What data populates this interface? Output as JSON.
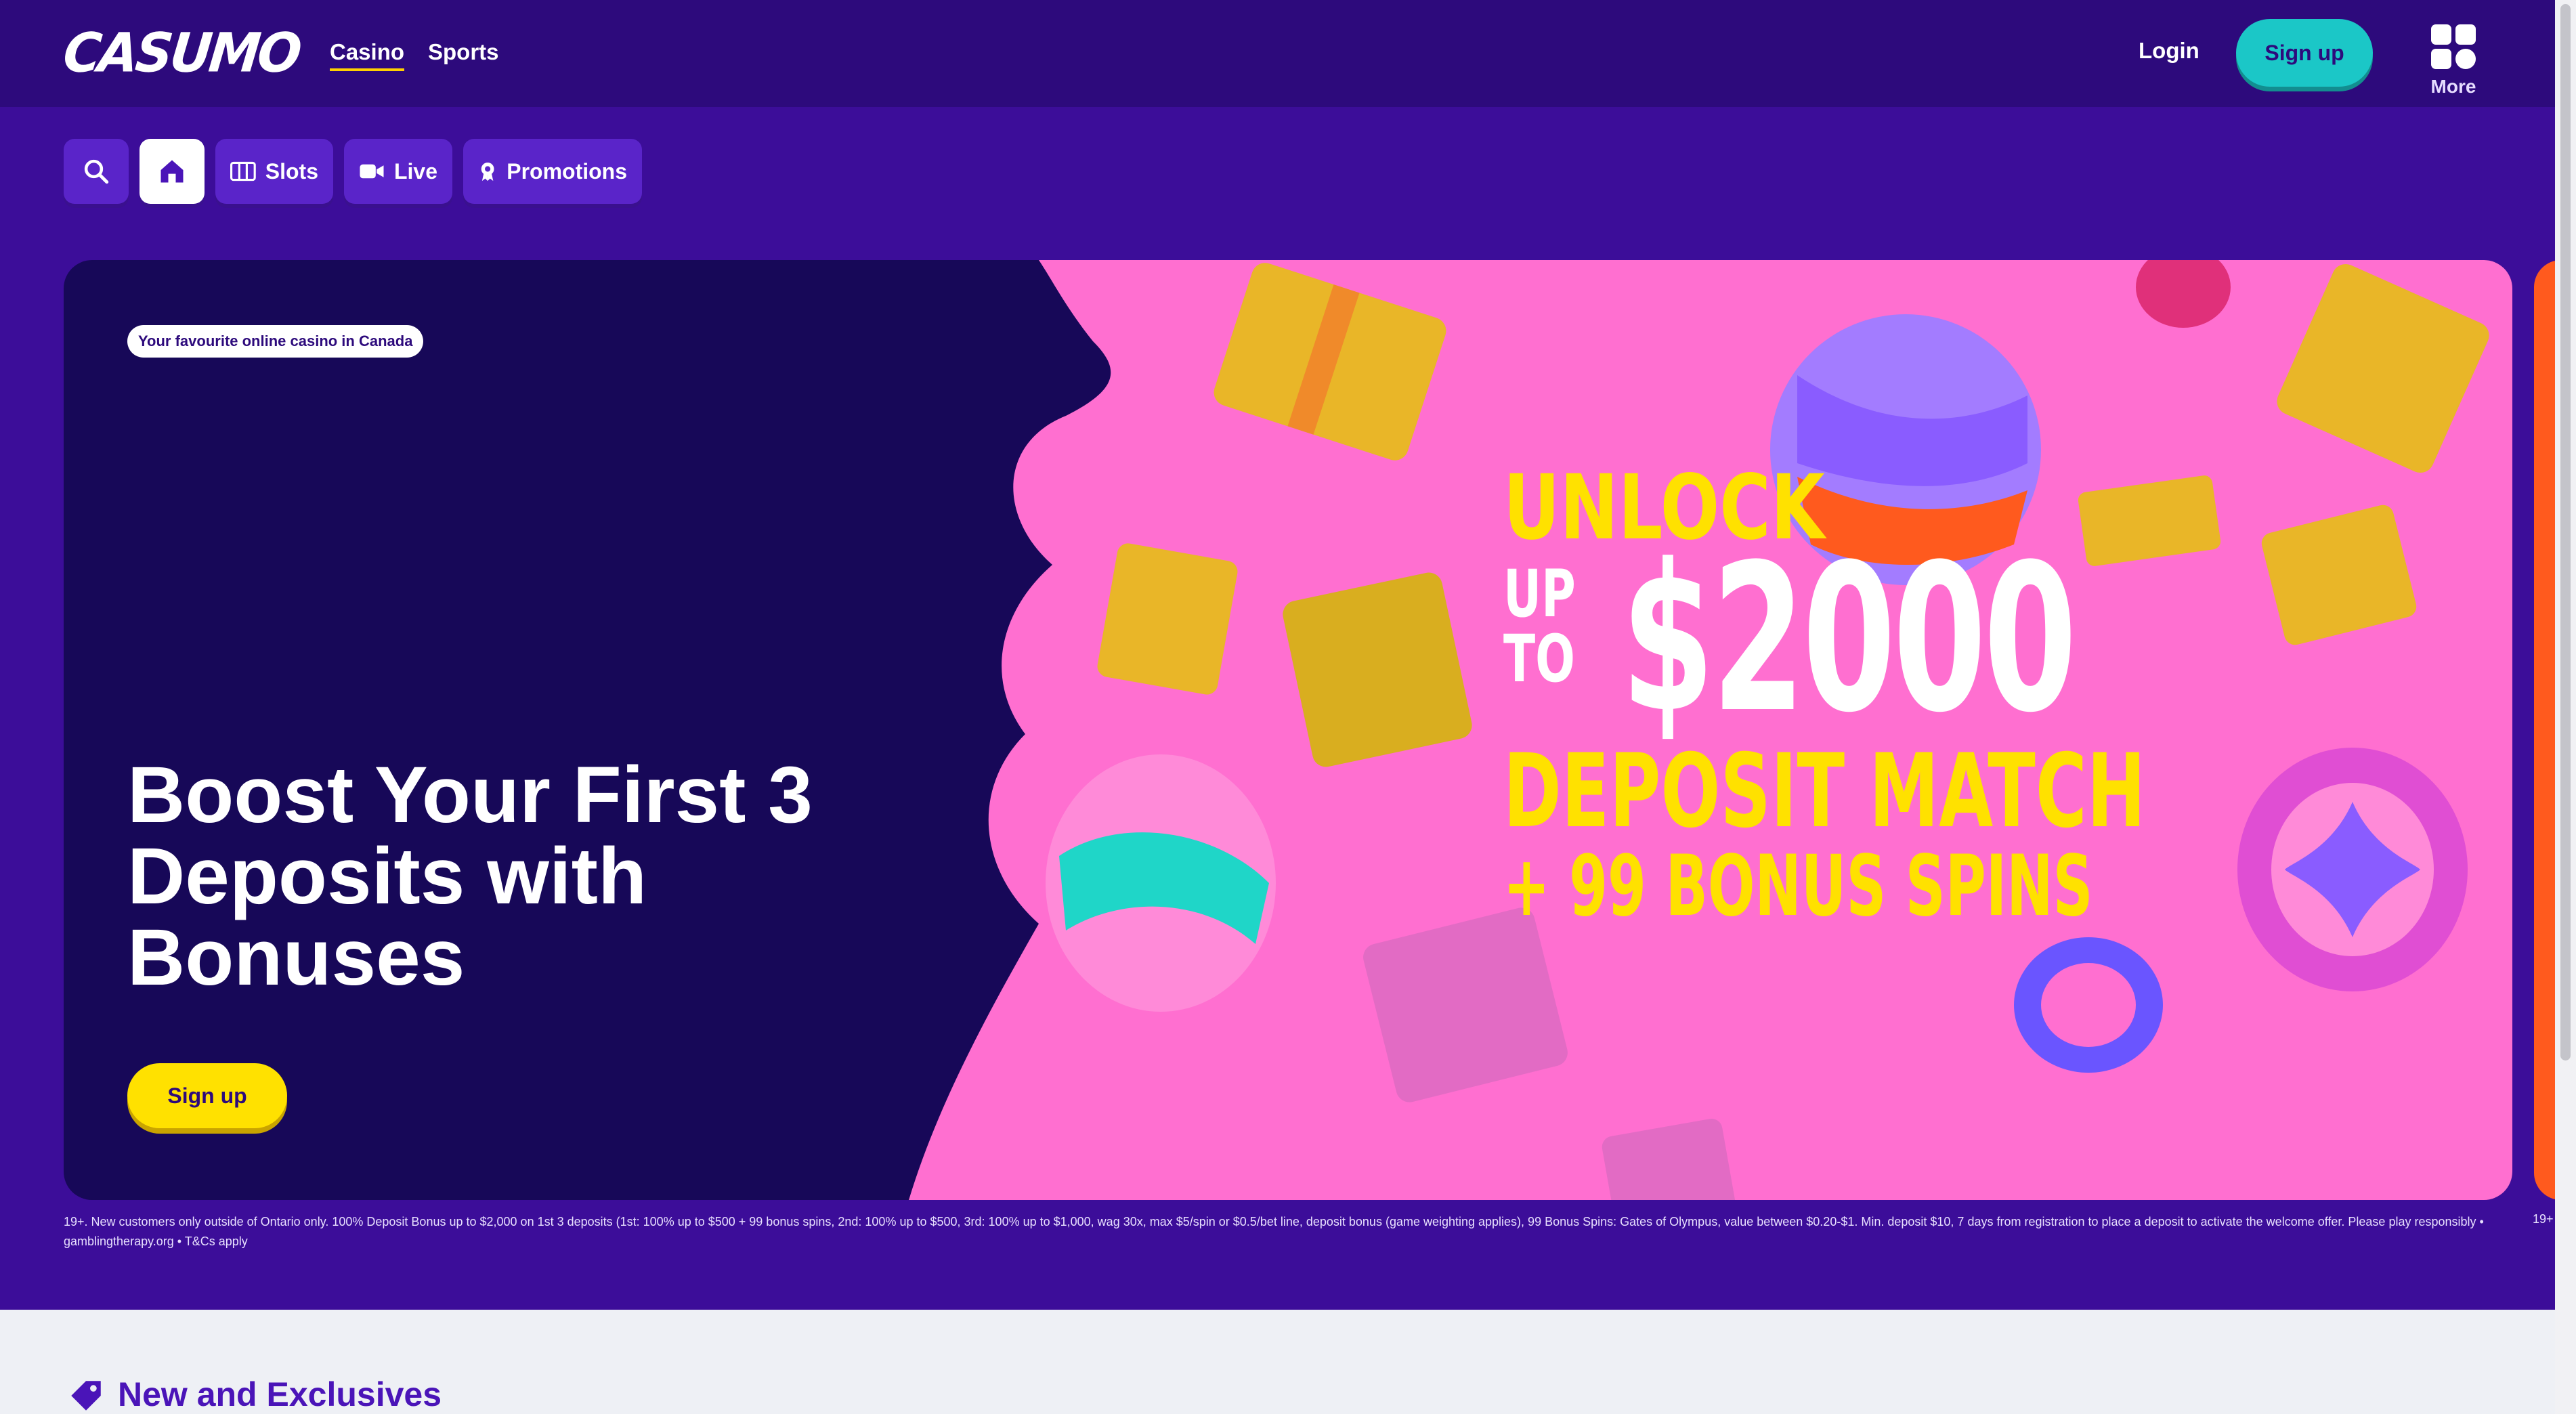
{
  "header": {
    "logo_text": "CASUMO",
    "nav": {
      "casino": "Casino",
      "sports": "Sports"
    },
    "login": "Login",
    "signup": "Sign up",
    "more": "More"
  },
  "categories": {
    "slots": "Slots",
    "live": "Live",
    "promotions": "Promotions"
  },
  "hero": {
    "badge": "Your favourite online casino in Canada",
    "title": "Boost Your First 3 Deposits with Bonuses",
    "signup": "Sign up",
    "promo": {
      "unlock": "UNLOCK",
      "up": "UP",
      "to": "TO",
      "amount": "$2000",
      "match": "DEPOSIT MATCH",
      "spins": "+ 99 BONUS SPINS"
    },
    "terms": "19+. New customers only outside of Ontario only. 100% Deposit Bonus up to $2,000 on 1st 3 deposits (1st: 100% up to $500 + 99 bonus spins, 2nd: 100% up to $500, 3rd: 100% up to $1,000, wag 30x, max $5/spin or $0.5/bet line, deposit bonus (game weighting applies), 99 Bonus Spins: Gates of Olympus, value between $0.20-$1. Min. deposit $10, 7 days from registration to place a deposit to activate the welcome offer. Please play responsibly • gamblingtherapy.org • T&Cs apply",
    "terms_next": "19+"
  },
  "section": {
    "title": "New and Exclusives"
  },
  "colors": {
    "header_bg": "#2d0a7c",
    "page_bg": "#3c0d99",
    "accent_teal": "#1bc7c7",
    "accent_yellow": "#ffe100",
    "hero_pink": "#ff6fd0",
    "hero_navy": "#170858"
  },
  "icons": [
    "search-icon",
    "home-icon",
    "slots-icon",
    "live-camera-icon",
    "promotions-icon",
    "more-grid-icon",
    "tag-icon"
  ]
}
